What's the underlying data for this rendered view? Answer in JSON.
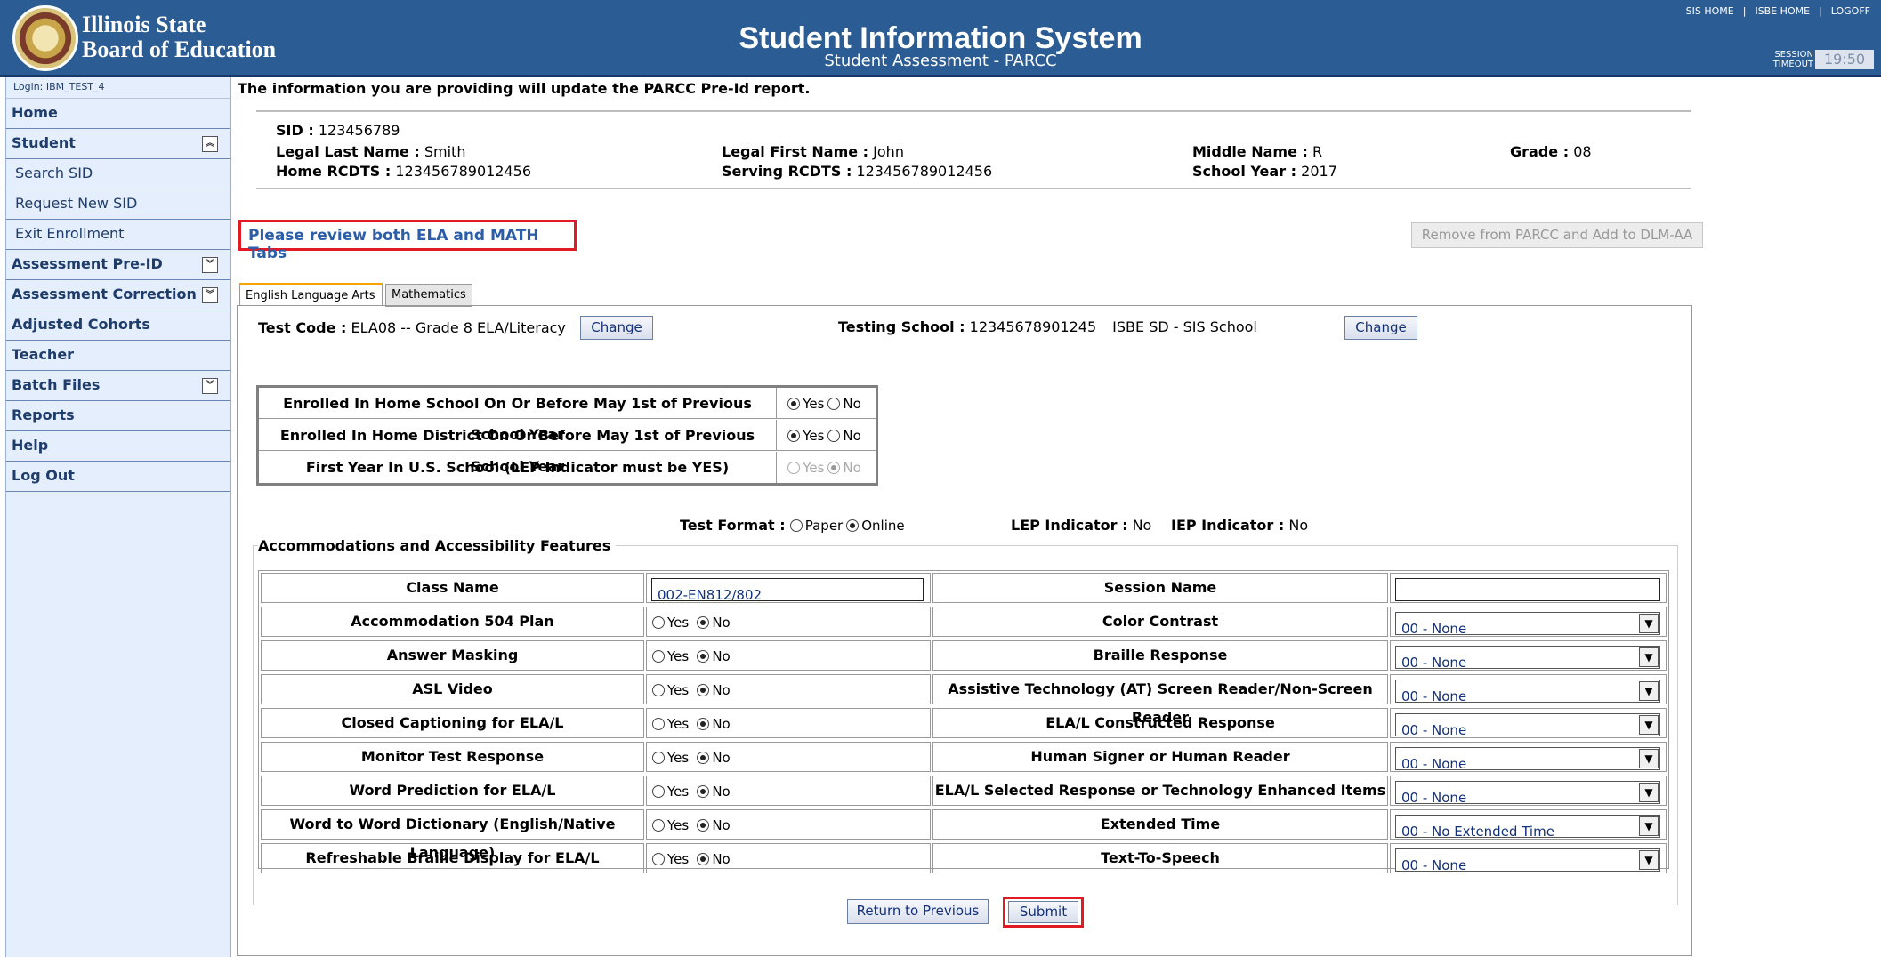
{
  "header": {
    "org_line1": "Illinois State",
    "org_line2": "Board of Education",
    "title": "Student Information System",
    "subtitle": "Student Assessment - PARCC",
    "links": [
      "SIS HOME",
      "ISBE HOME",
      "LOGOFF"
    ],
    "session_label_1": "SESSION",
    "session_label_2": "TIMEOUT",
    "session_time": "19:50"
  },
  "sidebar": {
    "login": "Login: IBM_TEST_4",
    "items": [
      {
        "label": "Home"
      },
      {
        "label": "Student"
      },
      {
        "label": "Search SID"
      },
      {
        "label": "Request New SID"
      },
      {
        "label": "Exit Enrollment"
      },
      {
        "label": "Assessment Pre-ID"
      },
      {
        "label": "Assessment Correction"
      },
      {
        "label": "Adjusted Cohorts"
      },
      {
        "label": "Teacher"
      },
      {
        "label": "Batch Files"
      },
      {
        "label": "Reports"
      },
      {
        "label": "Help"
      },
      {
        "label": "Log Out"
      }
    ]
  },
  "main": {
    "notice": "The information you are providing will update the PARCC Pre-Id report.",
    "student": {
      "sid_label": "SID :",
      "sid": "123456789",
      "last_label": "Legal Last Name :",
      "last": "Smith",
      "first_label": "Legal First Name :",
      "first": "John",
      "middle_label": "Middle Name :",
      "middle": "R",
      "grade_label": "Grade :",
      "grade": "08",
      "home_label": "Home RCDTS :",
      "home": "123456789012456",
      "serving_label": "Serving RCDTS :",
      "serving": "123456789012456",
      "year_label": "School Year :",
      "year": "2017"
    },
    "review_msg": "Please review both ELA and MATH Tabs",
    "remove_btn": "Remove from PARCC and Add to DLM-AA",
    "tabs": [
      "English Language Arts",
      "Mathematics"
    ],
    "test_code_label": "Test Code :",
    "test_code": "ELA08 -- Grade 8 ELA/Literacy",
    "change": "Change",
    "testing_school_label": "Testing School :",
    "testing_school_code": "12345678901245",
    "testing_school_name": "ISBE SD - SIS School",
    "enroll": [
      {
        "label": "Enrolled In Home School On Or Before May 1st of Previous School Year",
        "yes": "Yes",
        "no": "No"
      },
      {
        "label": "Enrolled In Home District On Or Before May 1st of Previous School Year",
        "yes": "Yes",
        "no": "No"
      },
      {
        "label": "First Year In U.S. School (LEP Indicator must be YES)",
        "yes": "Yes",
        "no": "No"
      }
    ],
    "test_format_label": "Test Format :",
    "paper": "Paper",
    "online": "Online",
    "lep_label": "LEP Indicator :",
    "lep": "No",
    "iep_label": "IEP Indicator :",
    "iep": "No",
    "acc_title": "Accommodations and Accessibility Features",
    "acc_rows": [
      {
        "left": "Class Name",
        "right": "Session Name"
      },
      {
        "left": "Accommodation 504 Plan",
        "right": "Color Contrast",
        "sel": "00 - None"
      },
      {
        "left": "Answer Masking",
        "right": "Braille Response",
        "sel": "00 - None"
      },
      {
        "left": "ASL Video",
        "right": "Assistive Technology (AT) Screen Reader/Non-Screen Reader",
        "sel": "00 - None"
      },
      {
        "left": "Closed Captioning for ELA/L",
        "right": "ELA/L Constructed Response",
        "sel": "00 - None"
      },
      {
        "left": "Monitor Test Response",
        "right": "Human Signer or Human Reader",
        "sel": "00 - None"
      },
      {
        "left": "Word Prediction for ELA/L",
        "right": "ELA/L Selected Response or Technology Enhanced Items",
        "sel": "00 - None"
      },
      {
        "left": "Word to Word Dictionary (English/Native Language)",
        "right": "Extended Time",
        "sel": "00 - No Extended Time"
      },
      {
        "left": "Refreshable Braille Display for ELA/L",
        "right": "Text-To-Speech",
        "sel": "00 - None"
      }
    ],
    "class_name_value": "002-EN812/802",
    "session_name_value": "",
    "yes": "Yes",
    "no": "No",
    "return_btn": "Return to Previous",
    "submit_btn": "Submit"
  }
}
